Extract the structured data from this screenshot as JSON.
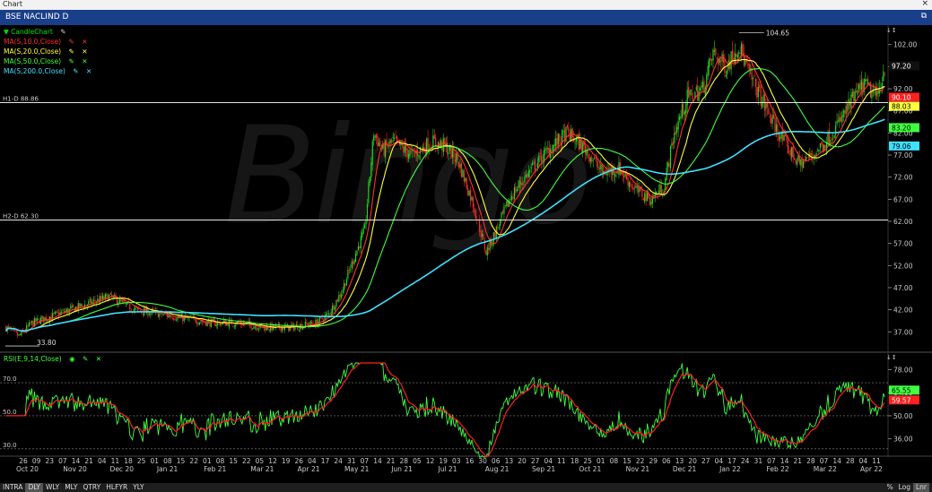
{
  "window": {
    "title": "Chart",
    "close_icon": "×"
  },
  "panel": {
    "title": "BSE NACLIND D",
    "restore_icon": "⧉"
  },
  "legend": [
    {
      "label": "▼ CandleChart",
      "color": "#00e000"
    },
    {
      "label": "MA(S,10.0,Close)",
      "color": "#ff3030"
    },
    {
      "label": "MA(S,20.0,Close)",
      "color": "#ffff40"
    },
    {
      "label": "MA(S,50.0,Close)",
      "color": "#40ff40"
    },
    {
      "label": "MA(S,200.0,Close)",
      "color": "#40e0ff"
    }
  ],
  "rsi_legend": {
    "label": "RSI(E,9,14,Close)",
    "color": "#40ff40"
  },
  "hlines": {
    "h1": {
      "label": "H1-D 88.86",
      "value": 88.86
    },
    "h2": {
      "label": "H2-D 62.30",
      "value": 62.3
    }
  },
  "annotations": {
    "high": "104.65",
    "low": "33.80"
  },
  "price_ticks": [
    "102.00",
    "97.00",
    "92.00",
    "87.00",
    "82.00",
    "77.00",
    "72.00",
    "67.00",
    "62.00",
    "57.00",
    "52.00",
    "47.00",
    "42.00",
    "37.00"
  ],
  "price_badges": [
    {
      "text": "97.20",
      "value": 97.2,
      "bg": "#111111",
      "fg": "#ffffff"
    },
    {
      "text": "90.10",
      "value": 90.1,
      "bg": "#ff2020",
      "fg": "#ffffff"
    },
    {
      "text": "88.03",
      "value": 88.03,
      "bg": "#ffff40",
      "fg": "#000000"
    },
    {
      "text": "83.20",
      "value": 83.2,
      "bg": "#40ff40",
      "fg": "#000000"
    },
    {
      "text": "79.06",
      "value": 79.06,
      "bg": "#40e0ff",
      "fg": "#000000"
    }
  ],
  "rsi_ticks": [
    "78.00",
    "64.00",
    "50.00",
    "36.00"
  ],
  "rsi_badges": [
    {
      "text": "65.55",
      "value": 65.55,
      "bg": "#40ff40",
      "fg": "#000000"
    },
    {
      "text": "59.57",
      "value": 59.57,
      "bg": "#ff2020",
      "fg": "#ffffff"
    }
  ],
  "rsi_levels": [
    "70.0",
    "50.0",
    "30.0"
  ],
  "date_labels": [
    "26",
    "09",
    "23",
    "07",
    "14",
    "21",
    "04",
    "11",
    "18",
    "25",
    "01",
    "08",
    "15",
    "22",
    "01",
    "08",
    "15",
    "22",
    "05",
    "12",
    "19",
    "26",
    "04",
    "17",
    "24",
    "31",
    "07",
    "14",
    "21",
    "28",
    "05",
    "12",
    "19",
    "03",
    "16",
    "30",
    "06",
    "13",
    "20",
    "27",
    "04",
    "11",
    "18",
    "25",
    "01",
    "08",
    "15",
    "22",
    "29",
    "06",
    "13",
    "20",
    "27",
    "04",
    "17",
    "24",
    "31",
    "07",
    "14",
    "21",
    "28",
    "07",
    "14",
    "28",
    "04",
    "11"
  ],
  "month_labels": [
    "Oct 20",
    "Nov 20",
    "Dec 20",
    "Jan 21",
    "Feb 21",
    "Mar 21",
    "Apr 21",
    "May 21",
    "Jun 21",
    "Jul 21",
    "Aug 21",
    "Sep 21",
    "Oct 21",
    "Nov 21",
    "Dec 21",
    "Jan 22",
    "Feb 22",
    "Mar 22",
    "Apr 22"
  ],
  "timeframes": [
    "INTRA",
    "DLY",
    "WLY",
    "MLY",
    "QTRY",
    "HLFYR",
    "YLY"
  ],
  "selected_timeframe": "DLY",
  "scale_buttons": [
    "%",
    "Log",
    "Lnr"
  ],
  "watermark": "Bingo",
  "chart_data": {
    "type": "line",
    "price_range": [
      33,
      106
    ],
    "rsi_range": [
      25,
      82
    ],
    "key_prices": [
      {
        "i": 0,
        "p": 38
      },
      {
        "i": 10,
        "p": 36
      },
      {
        "i": 20,
        "p": 39
      },
      {
        "i": 40,
        "p": 41
      },
      {
        "i": 60,
        "p": 43
      },
      {
        "i": 80,
        "p": 45
      },
      {
        "i": 100,
        "p": 42
      },
      {
        "i": 120,
        "p": 41
      },
      {
        "i": 140,
        "p": 40
      },
      {
        "i": 160,
        "p": 39
      },
      {
        "i": 180,
        "p": 39
      },
      {
        "i": 200,
        "p": 38
      },
      {
        "i": 220,
        "p": 38
      },
      {
        "i": 240,
        "p": 39
      },
      {
        "i": 250,
        "p": 41
      },
      {
        "i": 260,
        "p": 46
      },
      {
        "i": 270,
        "p": 54
      },
      {
        "i": 278,
        "p": 60
      },
      {
        "i": 285,
        "p": 82
      },
      {
        "i": 292,
        "p": 78
      },
      {
        "i": 300,
        "p": 80
      },
      {
        "i": 315,
        "p": 77
      },
      {
        "i": 330,
        "p": 80
      },
      {
        "i": 340,
        "p": 79
      },
      {
        "i": 350,
        "p": 76
      },
      {
        "i": 362,
        "p": 66
      },
      {
        "i": 372,
        "p": 55
      },
      {
        "i": 380,
        "p": 60
      },
      {
        "i": 392,
        "p": 68
      },
      {
        "i": 405,
        "p": 73
      },
      {
        "i": 420,
        "p": 78
      },
      {
        "i": 435,
        "p": 82
      },
      {
        "i": 450,
        "p": 78
      },
      {
        "i": 462,
        "p": 73
      },
      {
        "i": 475,
        "p": 74
      },
      {
        "i": 488,
        "p": 69
      },
      {
        "i": 500,
        "p": 67
      },
      {
        "i": 510,
        "p": 70
      },
      {
        "i": 518,
        "p": 82
      },
      {
        "i": 528,
        "p": 90
      },
      {
        "i": 540,
        "p": 92
      },
      {
        "i": 548,
        "p": 100
      },
      {
        "i": 558,
        "p": 97
      },
      {
        "i": 568,
        "p": 102
      },
      {
        "i": 575,
        "p": 96
      },
      {
        "i": 585,
        "p": 90
      },
      {
        "i": 595,
        "p": 84
      },
      {
        "i": 605,
        "p": 79
      },
      {
        "i": 615,
        "p": 75
      },
      {
        "i": 625,
        "p": 77
      },
      {
        "i": 635,
        "p": 80
      },
      {
        "i": 645,
        "p": 84
      },
      {
        "i": 655,
        "p": 89
      },
      {
        "i": 665,
        "p": 93
      },
      {
        "i": 675,
        "p": 90
      },
      {
        "i": 681,
        "p": 97
      }
    ],
    "ma_periods": [
      10,
      20,
      50,
      200
    ]
  }
}
